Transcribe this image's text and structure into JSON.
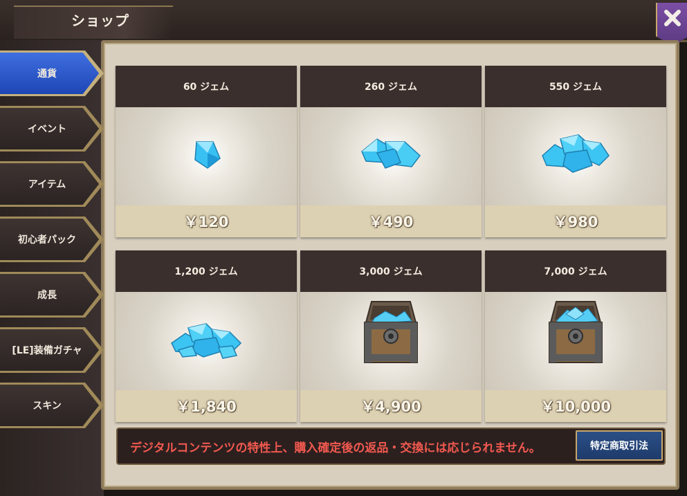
{
  "window": {
    "title": "ショップ"
  },
  "tabs": [
    {
      "label": "通貨",
      "active": true
    },
    {
      "label": "イベント",
      "active": false
    },
    {
      "label": "アイテム",
      "active": false
    },
    {
      "label": "初心者パック",
      "active": false
    },
    {
      "label": "成長",
      "active": false
    },
    {
      "label": "[LE]装備ガチャ",
      "active": false
    },
    {
      "label": "スキン",
      "active": false
    }
  ],
  "products": [
    {
      "name": "60 ジェム",
      "price": "￥120",
      "icon": "gem-single-icon"
    },
    {
      "name": "260 ジェム",
      "price": "￥490",
      "icon": "gem-small-pile-icon"
    },
    {
      "name": "550 ジェム",
      "price": "￥980",
      "icon": "gem-pile-icon"
    },
    {
      "name": "1,200 ジェム",
      "price": "￥1,840",
      "icon": "gem-large-pile-icon"
    },
    {
      "name": "3,000 ジェム",
      "price": "￥4,900",
      "icon": "gem-chest-icon"
    },
    {
      "name": "7,000 ジェム",
      "price": "￥10,000",
      "icon": "gem-chest-icon"
    }
  ],
  "notice": {
    "text": "デジタルコンテンツの特性上、購入確定後の返品・交換には応じられません。"
  },
  "legal_button": {
    "label": "特定商取引法"
  },
  "colors": {
    "active_tab": "#2f5bd0",
    "card_header": "#3b2f2d",
    "notice_text": "#f2594f",
    "close_banner": "#6b449a"
  }
}
